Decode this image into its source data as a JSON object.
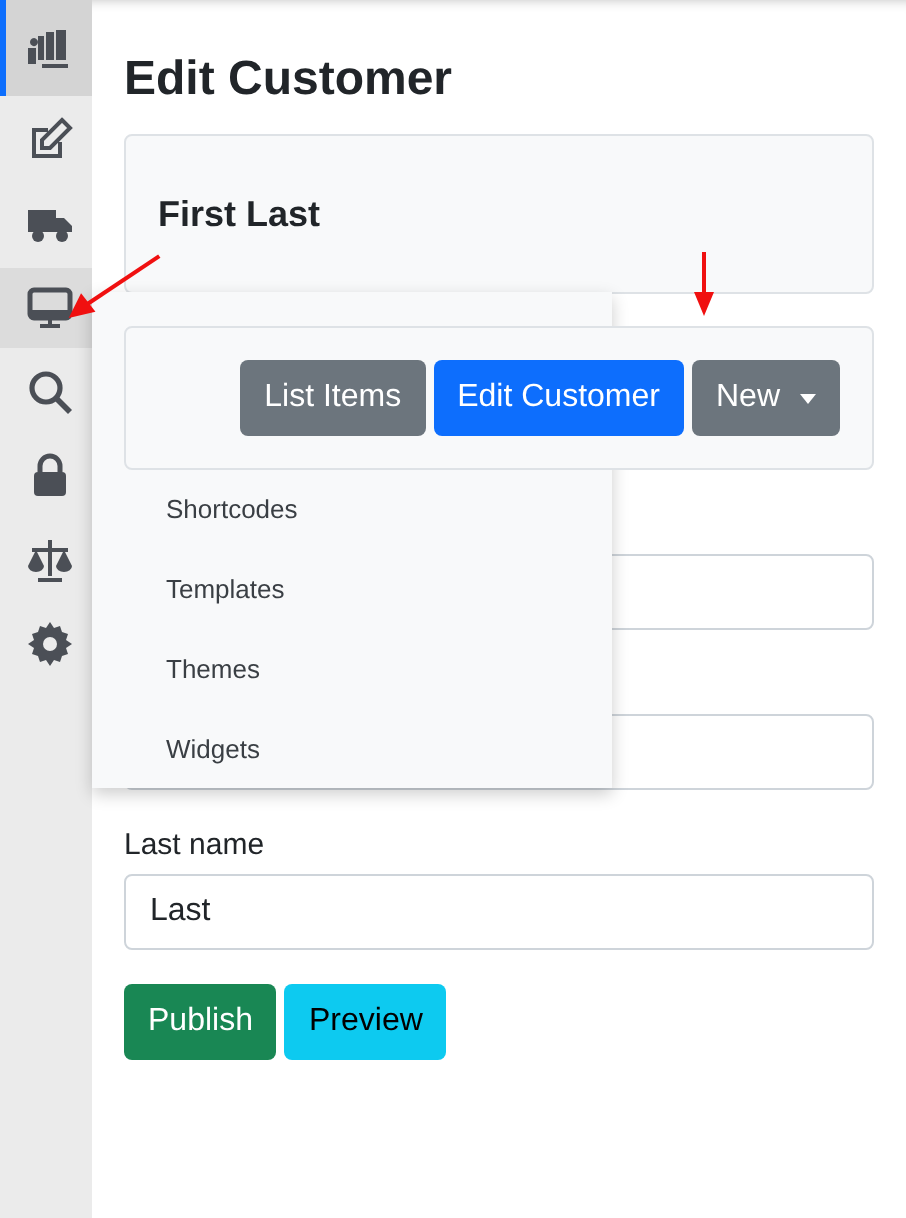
{
  "sidebar": {
    "items": [
      {
        "selected": true,
        "expanded": false
      },
      {
        "selected": false,
        "expanded": false
      },
      {
        "selected": false,
        "expanded": false
      },
      {
        "selected": false,
        "expanded": true,
        "menu": [
          "Shortcodes",
          "Templates",
          "Themes",
          "Widgets"
        ]
      },
      {
        "selected": false,
        "expanded": false
      },
      {
        "selected": false,
        "expanded": false
      },
      {
        "selected": false,
        "expanded": false
      },
      {
        "selected": false,
        "expanded": false
      }
    ]
  },
  "page_title": "Edit Customer",
  "customer_card": {
    "name": "First Last"
  },
  "toolbar": {
    "buttons": [
      {
        "label": "List Items",
        "kind": "secondary",
        "caret": false
      },
      {
        "label": "Edit Customer",
        "kind": "primary",
        "caret": false
      },
      {
        "label": "New",
        "kind": "secondary",
        "caret": true
      }
    ]
  },
  "fields": [
    {
      "kind": "covered"
    },
    {
      "kind": "covered"
    },
    {
      "kind": "text",
      "label": "Last name",
      "value": "Last"
    }
  ],
  "actions": [
    {
      "label": "Publish",
      "kind": "success"
    },
    {
      "label": "Preview",
      "kind": "info"
    }
  ],
  "annotations": [
    {
      "kind": "arrow"
    },
    {
      "kind": "arrow"
    }
  ]
}
